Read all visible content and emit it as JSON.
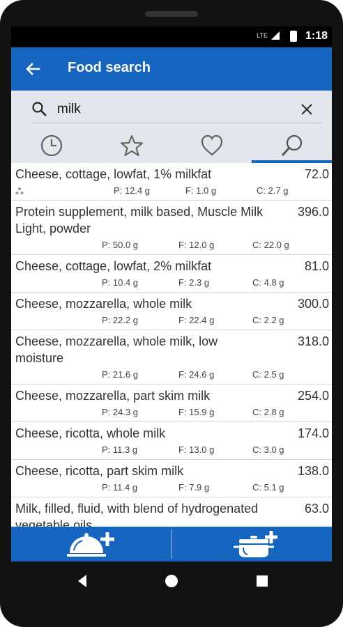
{
  "status": {
    "network": "LTE",
    "time": "1:18"
  },
  "appbar": {
    "title": "Food search"
  },
  "search": {
    "value": "milk",
    "placeholder": ""
  },
  "tabs": [
    {
      "name": "recent",
      "icon": "clock-icon"
    },
    {
      "name": "favorites",
      "icon": "star-icon"
    },
    {
      "name": "liked",
      "icon": "heart-icon"
    },
    {
      "name": "search",
      "icon": "search-icon",
      "active": true
    }
  ],
  "foods": [
    {
      "name": "Cheese, cottage, lowfat, 1% milkfat",
      "kcal": "72.0",
      "p": "P: 12.4 g",
      "f": "F: 1.0 g",
      "c": "C: 2.7 g"
    },
    {
      "name": "Protein supplement, milk based, Muscle Milk Light, powder",
      "kcal": "396.0",
      "p": "P: 50.0 g",
      "f": "F: 12.0 g",
      "c": "C: 22.0 g"
    },
    {
      "name": "Cheese, cottage, lowfat, 2% milkfat",
      "kcal": "81.0",
      "p": "P: 10.4 g",
      "f": "F: 2.3 g",
      "c": "C: 4.8 g"
    },
    {
      "name": "Cheese, mozzarella, whole milk",
      "kcal": "300.0",
      "p": "P: 22.2 g",
      "f": "F: 22.4 g",
      "c": "C: 2.2 g"
    },
    {
      "name": "Cheese, mozzarella, whole milk, low moisture",
      "kcal": "318.0",
      "p": "P: 21.6 g",
      "f": "F: 24.6 g",
      "c": "C: 2.5 g"
    },
    {
      "name": "Cheese, mozzarella, part skim milk",
      "kcal": "254.0",
      "p": "P: 24.3 g",
      "f": "F: 15.9 g",
      "c": "C: 2.8 g"
    },
    {
      "name": "Cheese, ricotta, whole milk",
      "kcal": "174.0",
      "p": "P: 11.3 g",
      "f": "F: 13.0 g",
      "c": "C: 3.0 g"
    },
    {
      "name": "Cheese, ricotta, part skim milk",
      "kcal": "138.0",
      "p": "P: 11.4 g",
      "f": "F: 7.9 g",
      "c": "C: 5.1 g"
    },
    {
      "name": "Milk, filled, fluid, with blend of hydrogenated vegetable oils",
      "kcal": "63.0",
      "p": "",
      "f": "",
      "c": ""
    }
  ],
  "bottombar": [
    {
      "name": "add-meal",
      "icon": "serving-dish-plus-icon"
    },
    {
      "name": "add-recipe",
      "icon": "cooking-pot-plus-icon"
    }
  ],
  "navbar": [
    {
      "name": "back",
      "icon": "triangle-back-icon"
    },
    {
      "name": "home",
      "icon": "circle-home-icon"
    },
    {
      "name": "recents",
      "icon": "square-recents-icon"
    }
  ],
  "colors": {
    "primary": "#1565c0",
    "searchBg": "#e3e7ed",
    "text": "#333333"
  }
}
